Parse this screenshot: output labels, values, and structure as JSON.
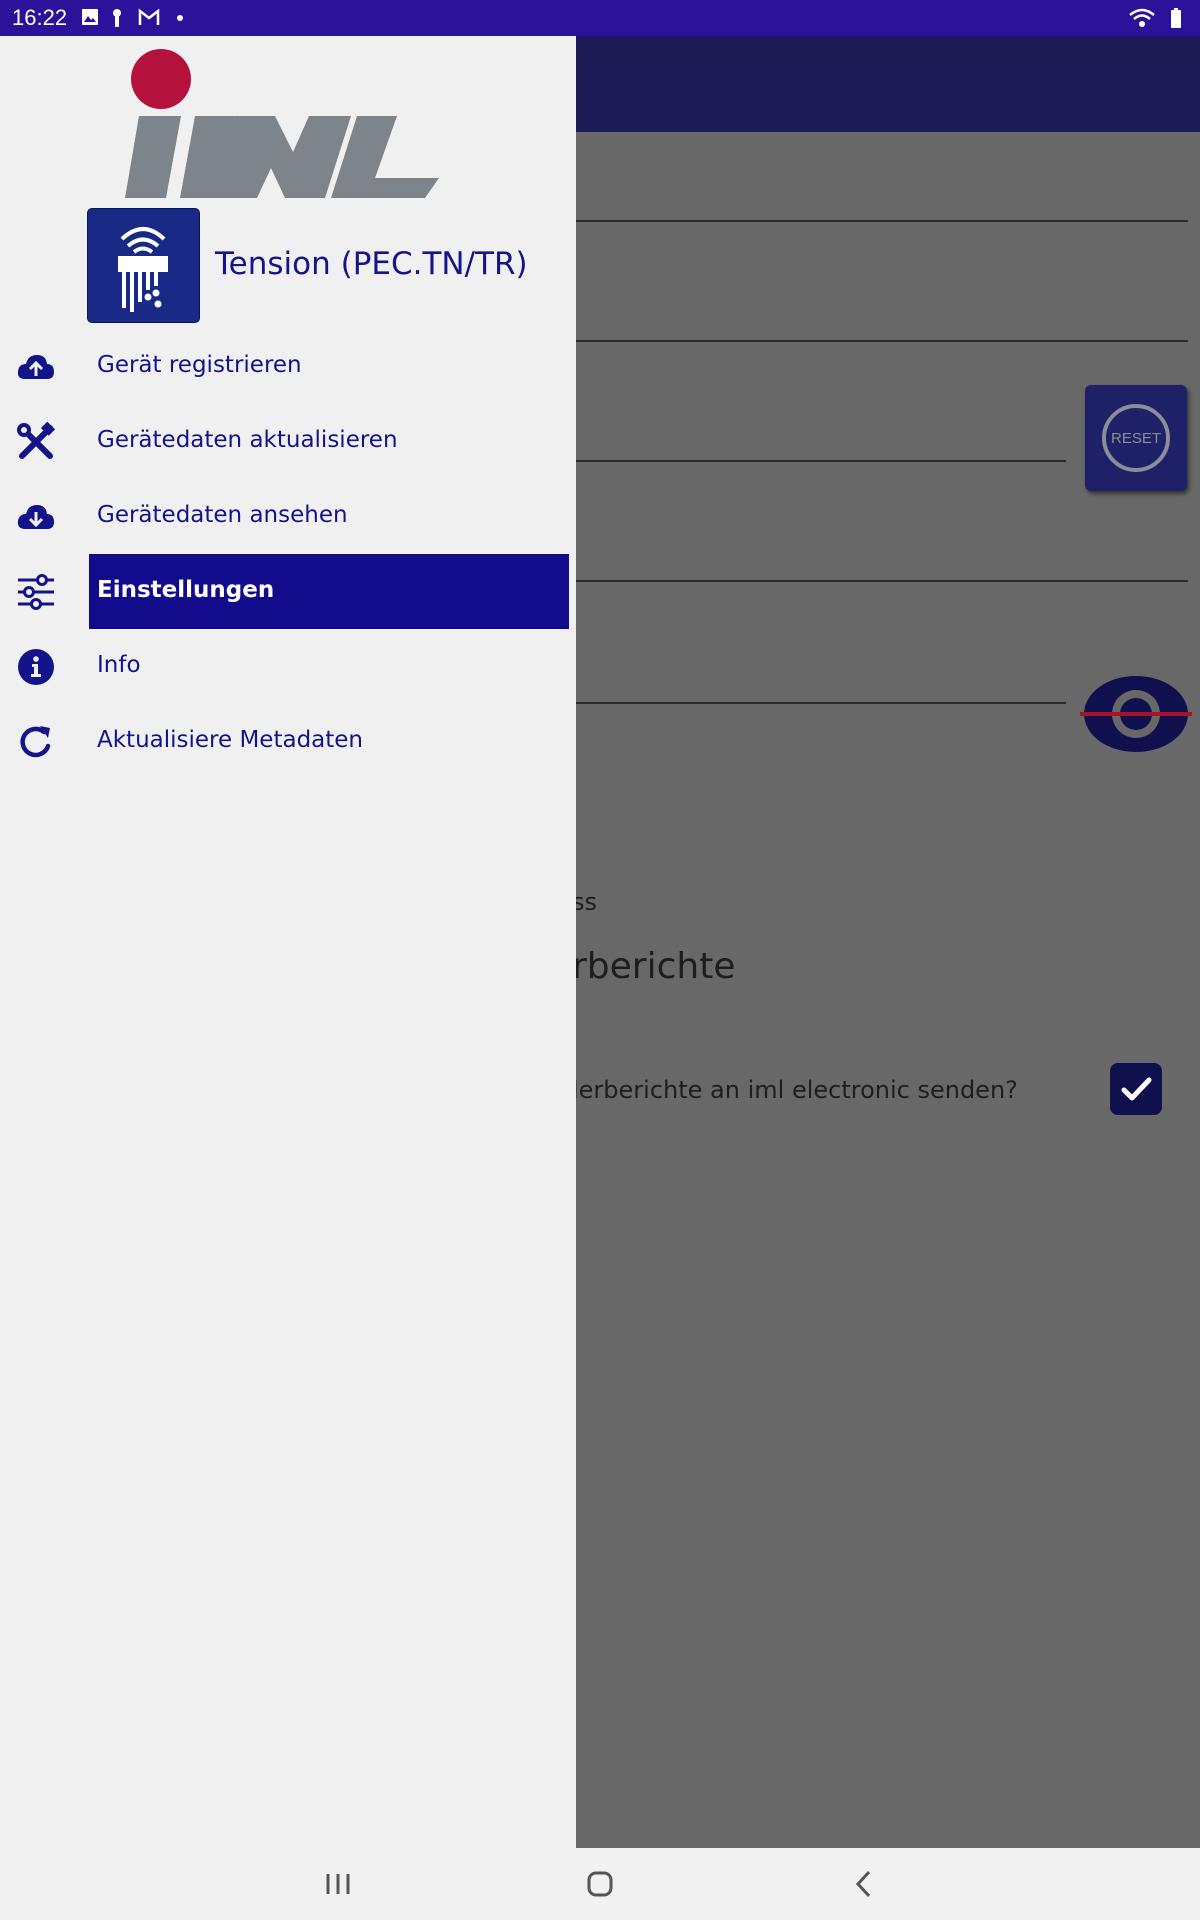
{
  "status_bar": {
    "time": "16:22",
    "icons": [
      "image-icon",
      "key-icon",
      "gmail-icon",
      "dot-icon",
      "wifi-icon",
      "battery-icon"
    ]
  },
  "colors": {
    "status_bar": "#2a129a",
    "drawer_bg": "#f0f0f0",
    "menu_text": "#14148a",
    "active_bg": "#120c8c",
    "logo_dot": "#b4123c",
    "logo_letters": "#7d858a",
    "scrim": "#686868"
  },
  "drawer": {
    "logo_text": "iml",
    "device_title": "Tension (PEC.TN/TR)",
    "menu": [
      {
        "label": "Gerät registrieren",
        "icon": "cloud-upload-icon",
        "active": false
      },
      {
        "label": "Gerätedaten aktualisieren",
        "icon": "tools-icon",
        "active": false
      },
      {
        "label": "Gerätedaten ansehen",
        "icon": "cloud-download-icon",
        "active": false
      },
      {
        "label": "Einstellungen",
        "icon": "sliders-icon",
        "active": true
      },
      {
        "label": "Info",
        "icon": "info-icon",
        "active": false
      },
      {
        "label": "Aktualisiere Metadaten",
        "icon": "refresh-icon",
        "active": false
      }
    ]
  },
  "background": {
    "reset_label": "RESET",
    "fragment_ss": "ss",
    "fragment_heading": "rberichte",
    "fragment_question": "lerberichte an iml electronic senden?",
    "checkbox_checked": true
  },
  "navbar": {
    "buttons": [
      "recent-apps-icon",
      "home-icon",
      "back-icon"
    ]
  }
}
